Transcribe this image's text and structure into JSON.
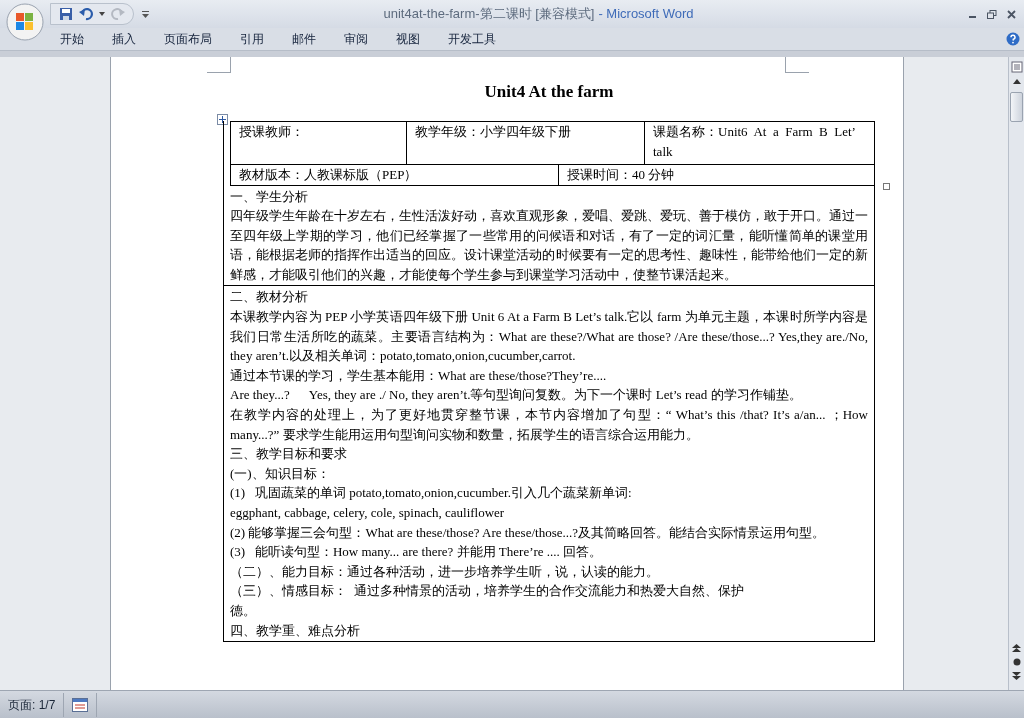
{
  "window": {
    "document_title": "unit4at-the-farm-第二课时 [兼容模式]",
    "app_name": "- Microsoft Word"
  },
  "ribbon_tabs": [
    "开始",
    "插入",
    "页面布局",
    "引用",
    "邮件",
    "审阅",
    "视图",
    "开发工具"
  ],
  "document": {
    "title": "Unit4 At the farm",
    "info_table": {
      "rows": [
        {
          "cells": [
            "授课教师：",
            "教学年级：小学四年级下册",
            "课题名称：Unit6  At  a  Farm  B  Let’ talk"
          ]
        },
        {
          "cells": [
            "教材版本：人教课标版（PEP）",
            "授课时间：40 分钟"
          ]
        }
      ]
    },
    "sections": [
      {
        "paragraphs": [
          "一、学生分析",
          "四年级学生年龄在十岁左右，生性活泼好动，喜欢直观形象，爱唱、爱跳、爱玩、善于模仿，敢于开口。通过一至四年级上学期的学习，他们已经掌握了一些常用的问候语和对话，有了一定的词汇量，能听懂简单的课堂用语，能根据老师的指挥作出适当的回应。设计课堂活动的时候要有一定的思考性、趣味性，能带给他们一定的新鲜感，才能吸引他们的兴趣，才能使每个学生参与到课堂学习活动中，使整节课活起来。"
        ]
      },
      {
        "paragraphs": [
          "二、教材分析",
          "本课教学内容为 PEP 小学英语四年级下册 Unit 6 At a Farm B Let’s talk.它以 farm 为单元主题，本课时所学内容是我们日常生活所吃的蔬菜。主要语言结构为：What are these?/What are those? /Are these/those...? Yes,they are./No, they aren’t.以及相关单词：potato,tomato,onion,cucumber,carrot.",
          "通过本节课的学习，学生基本能用：What are these/those?They’re....",
          "Are they...?      Yes, they are ./ No, they aren’t.等句型询问复数。为下一个课时 Let’s read 的学习作铺垫。",
          "在教学内容的处理上，为了更好地贯穿整节课，本节内容增加了句型：“ What’s this /that? It’s a/an... ；How many...?” 要求学生能用运用句型询问实物和数量，拓展学生的语言综合运用能力。",
          "三、教学目标和要求",
          "(一)、知识目标：",
          "(1)   巩固蔬菜的单词 potato,tomato,onion,cucumber.引入几个蔬菜新单词:",
          "eggphant, cabbage, celery, cole, spinach, cauliflower",
          "(2) 能够掌握三会句型：What are these/those? Are these/those...?及其简略回答。能结合实际情景运用句型。",
          "(3)   能听读句型：How many... are there? 并能用 There’re .... 回答。",
          "（二）、能力目标：通过各种活动，进一步培养学生听，说，认读的能力。",
          "（三）、情感目标：  通过多种情景的活动，培养学生的合作交流能力和热爱大自然、保护",
          "德。",
          "四、教学重、难点分析"
        ]
      }
    ]
  },
  "status_bar": {
    "page": "页面: 1/7"
  }
}
